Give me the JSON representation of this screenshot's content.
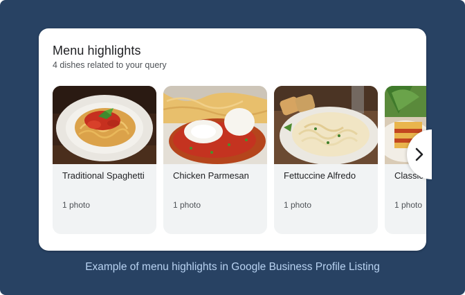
{
  "card": {
    "title": "Menu highlights",
    "subtitle": "4 dishes related to your query"
  },
  "dishes": [
    {
      "name": "Traditional Spaghetti",
      "photos": "1 photo",
      "image": "spaghetti-photo"
    },
    {
      "name": "Chicken Parmesan",
      "photos": "1 photo",
      "image": "chicken-parmesan-photo"
    },
    {
      "name": "Fettuccine Alfredo",
      "photos": "1 photo",
      "image": "fettuccine-alfredo-photo"
    },
    {
      "name": "Classic",
      "photos": "1 photo",
      "image": "lasagna-photo"
    }
  ],
  "carousel": {
    "next_icon": "chevron-right-icon"
  },
  "caption": "Example of menu highlights in Google Business Profile Listing",
  "colors": {
    "frame_background": "#284263",
    "card_background": "#ffffff",
    "tile_background": "#f1f3f4",
    "caption_text": "#b9d3f2"
  }
}
